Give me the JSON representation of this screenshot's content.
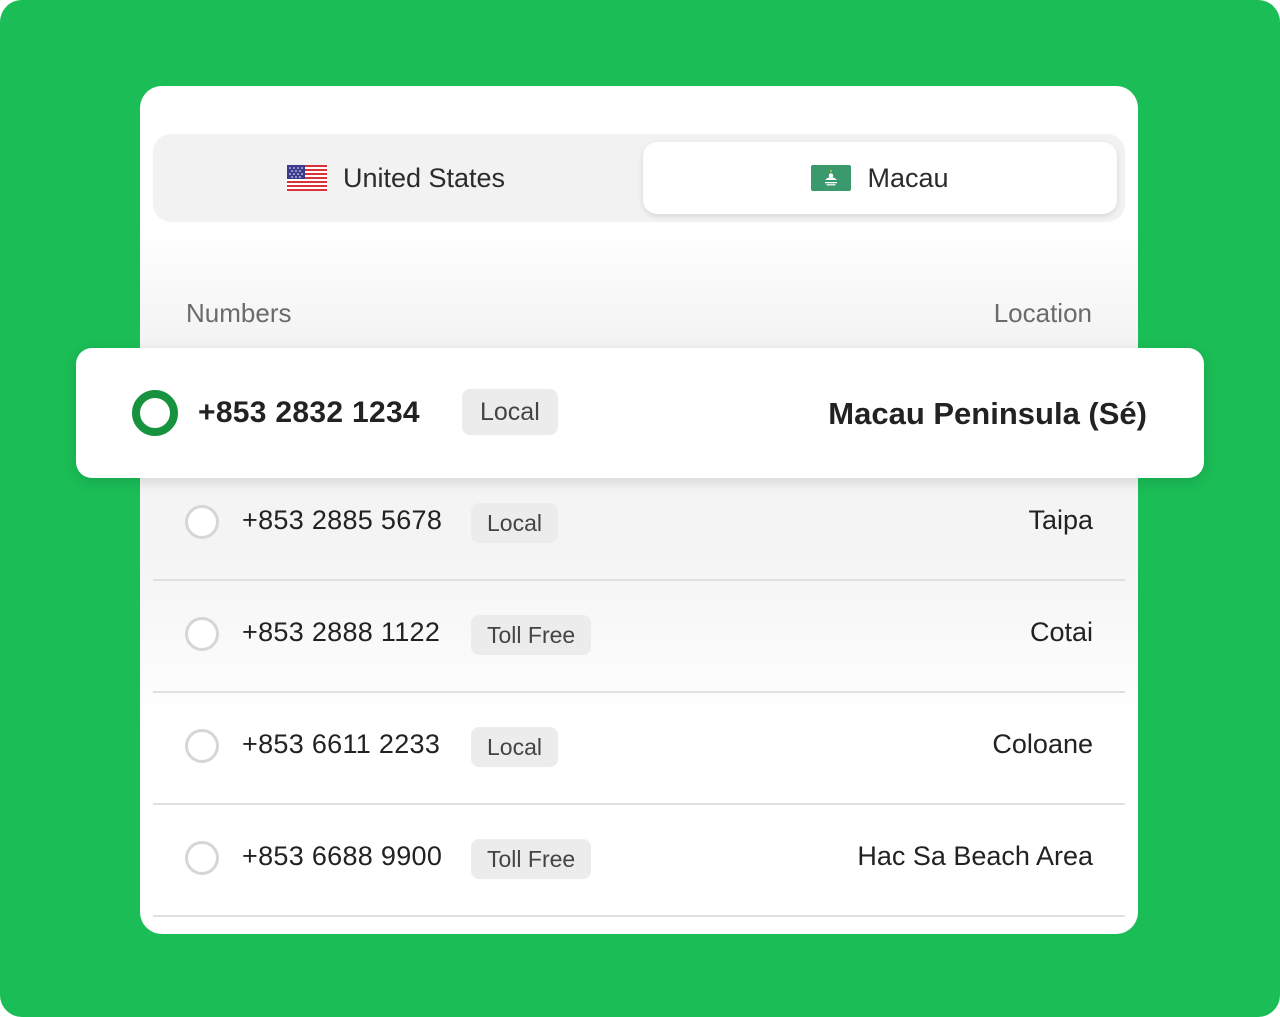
{
  "tabs": [
    {
      "label": "United States",
      "flag": "us-flag-icon",
      "active": false
    },
    {
      "label": "Macau",
      "flag": "macau-flag-icon",
      "active": true
    }
  ],
  "table": {
    "headers": {
      "numbers": "Numbers",
      "location": "Location"
    },
    "rows": [
      {
        "number": "+853 2832 1234",
        "type": "Local",
        "location": "Macau Peninsula (Sé)",
        "selected": true
      },
      {
        "number": "+853 2885 5678",
        "type": "Local",
        "location": "Taipa",
        "selected": false
      },
      {
        "number": "+853 2888 1122",
        "type": "Toll Free",
        "location": "Cotai",
        "selected": false
      },
      {
        "number": "+853 6611 2233",
        "type": "Local",
        "location": "Coloane",
        "selected": false
      },
      {
        "number": "+853 6688 9900",
        "type": "Toll Free",
        "location": "Hac Sa Beach Area",
        "selected": false
      }
    ]
  },
  "colors": {
    "background": "#1bbd57",
    "selected_radio": "#17923f",
    "macau_flag": "#3a9a6e"
  }
}
